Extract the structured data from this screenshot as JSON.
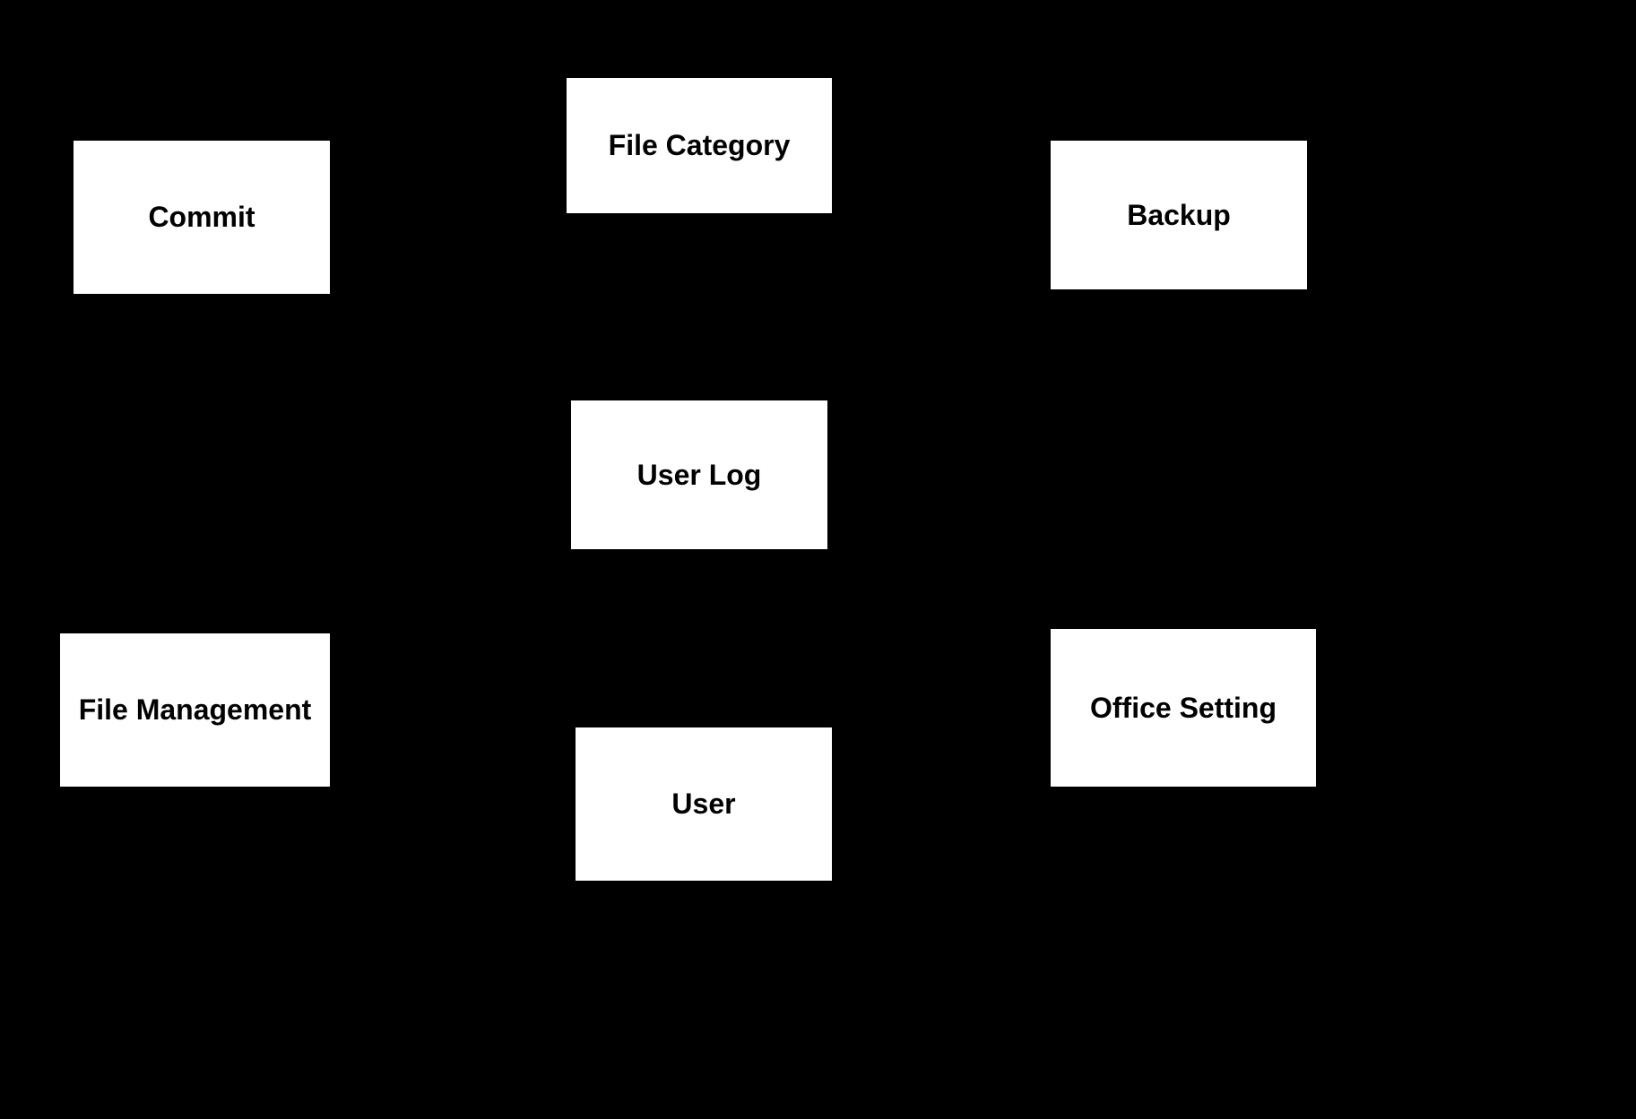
{
  "diagram": {
    "boxes": {
      "commit": "Commit",
      "file_category": "File Category",
      "backup": "Backup",
      "user_log": "User Log",
      "file_management": "File Management",
      "office_setting": "Office Setting",
      "user": "User"
    }
  }
}
